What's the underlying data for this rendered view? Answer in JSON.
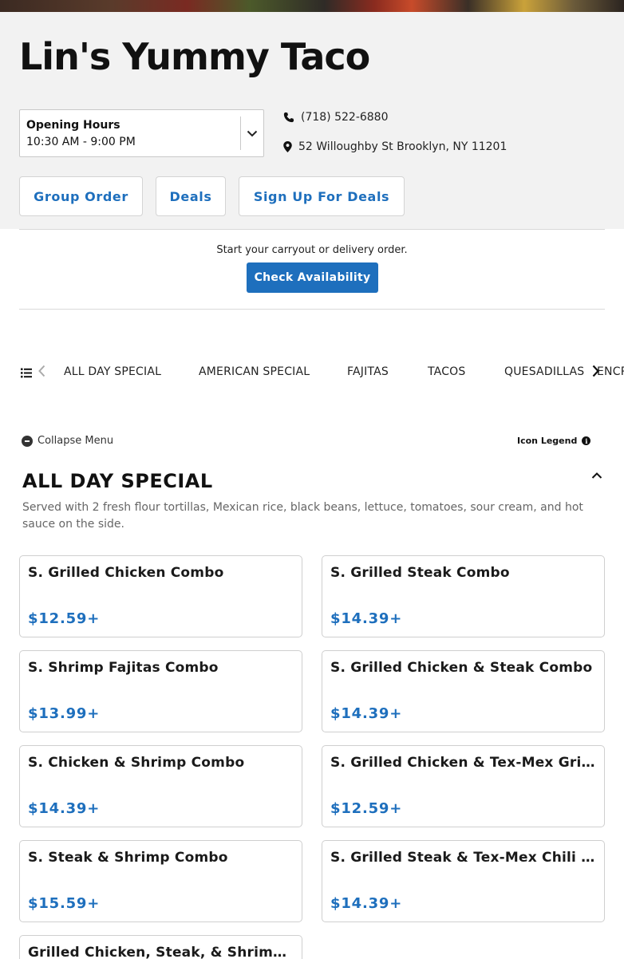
{
  "restaurant": {
    "name": "Lin's Yummy Taco"
  },
  "hours": {
    "label": "Opening Hours",
    "value": "10:30 AM - 9:00 PM"
  },
  "contact": {
    "phone": "(718) 522-6880",
    "address": "52 Willoughby St Brooklyn, NY 11201"
  },
  "actions": {
    "group_order": "Group Order",
    "deals": "Deals",
    "sign_up": "Sign Up For Deals"
  },
  "availability": {
    "prompt": "Start your carryout or delivery order.",
    "button": "Check Availability"
  },
  "categories": [
    "ALL DAY SPECIAL",
    "AMERICAN SPECIAL",
    "FAJITAS",
    "TACOS",
    "QUESADILLAS",
    "ENCRO"
  ],
  "menu_controls": {
    "collapse": "Collapse Menu",
    "legend": "Icon Legend"
  },
  "section": {
    "title": "ALL DAY SPECIAL",
    "description": "Served with 2 fresh flour tortillas, Mexican rice, black beans, lettuce, tomatoes, sour cream, and hot sauce on the side."
  },
  "items": [
    {
      "name": "S. Grilled Chicken Combo",
      "price": "$12.59+"
    },
    {
      "name": "S. Grilled Steak Combo",
      "price": "$14.39+"
    },
    {
      "name": "S. Shrimp Fajitas Combo",
      "price": "$13.99+"
    },
    {
      "name": "S. Grilled Chicken & Steak Combo",
      "price": "$14.39+"
    },
    {
      "name": "S. Chicken & Shrimp Combo",
      "price": "$14.39+"
    },
    {
      "name": "S. Grilled Chicken & Tex-Mex Grilled Combo",
      "price": "$12.59+"
    },
    {
      "name": "S. Steak & Shrimp Combo",
      "price": "$15.59+"
    },
    {
      "name": "S. Grilled Steak & Tex-Mex Chili Combo",
      "price": "$14.39+"
    },
    {
      "name": "Grilled Chicken, Steak, & Shrimp Combo",
      "price": ""
    }
  ],
  "colors": {
    "accent": "#1e6fbd",
    "header_bg": "#f2f2f2"
  }
}
